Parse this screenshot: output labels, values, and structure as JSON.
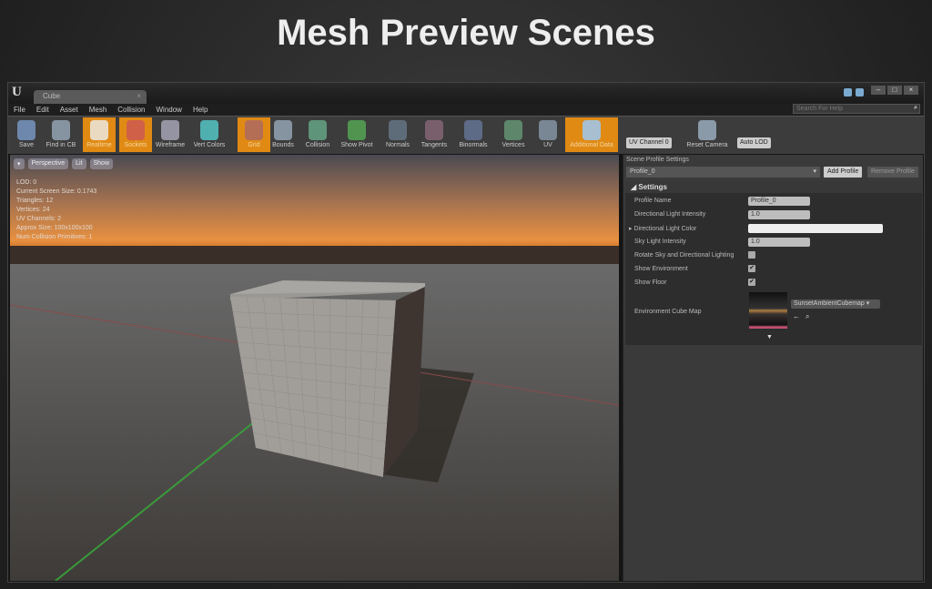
{
  "slide": {
    "title": "Mesh Preview Scenes"
  },
  "window": {
    "tab_title": "Cube",
    "search_placeholder": "Search For Help"
  },
  "menu": [
    "File",
    "Edit",
    "Asset",
    "Mesh",
    "Collision",
    "Window",
    "Help"
  ],
  "toolbar": [
    {
      "label": "Save",
      "icon": "save-icon",
      "active": false
    },
    {
      "label": "Find in CB",
      "icon": "magnifier-icon",
      "active": false
    },
    {
      "label": "Realtime",
      "icon": "stopwatch-icon",
      "active": true
    },
    {
      "label": "Sockets",
      "icon": "socket-icon",
      "active": true
    },
    {
      "label": "Wireframe",
      "icon": "wireframe-icon",
      "active": false
    },
    {
      "label": "Vert Colors",
      "icon": "brush-icon",
      "active": false
    },
    {
      "label": "Grid",
      "icon": "grid-icon",
      "active": true
    },
    {
      "label": "Bounds",
      "icon": "bounds-icon",
      "active": false
    },
    {
      "label": "Collision",
      "icon": "collision-icon",
      "active": false
    },
    {
      "label": "Show Pivot",
      "icon": "pivot-icon",
      "active": false
    },
    {
      "label": "Normals",
      "icon": "normals-icon",
      "active": false
    },
    {
      "label": "Tangents",
      "icon": "tangents-icon",
      "active": false
    },
    {
      "label": "Binormals",
      "icon": "binormals-icon",
      "active": false
    },
    {
      "label": "Vertices",
      "icon": "vertices-icon",
      "active": false
    },
    {
      "label": "UV",
      "icon": "uv-icon",
      "active": false
    },
    {
      "label": "Additional Data",
      "icon": "additional-data-icon",
      "active": true
    }
  ],
  "uv_channel": "UV Channel 0",
  "reset_camera": "Reset Camera",
  "lod": "Auto LOD",
  "viewport": {
    "buttons": [
      "Perspective",
      "Lit",
      "Show"
    ],
    "stats": [
      "LOD:  0",
      "Current Screen Size:  0.1743",
      "Triangles:  12",
      "Vertices:  24",
      "UV Channels:  2",
      "Approx Size: 100x100x100",
      "Num Collision Primitives:  1"
    ]
  },
  "panel": {
    "title": "Scene Profile Settings",
    "profile": "Profile_0",
    "add": "Add Profile",
    "remove": "Remove Profile",
    "section": "Settings",
    "rows": {
      "profile_name": "Profile Name",
      "profile_name_value": "Profile_0",
      "dir_intensity": "Directional Light Intensity",
      "dir_intensity_value": "1.0",
      "dir_color": "Directional Light Color",
      "sky_intensity": "Sky Light Intensity",
      "sky_intensity_value": "1.0",
      "rotate": "Rotate Sky and Directional Lighting",
      "show_env": "Show Environment",
      "show_floor": "Show Floor",
      "cube_map": "Environment Cube Map",
      "cube_map_value": "SunsetAmbientCubemap"
    },
    "checks": {
      "rotate": false,
      "show_env": true,
      "show_floor": true
    }
  },
  "colors": {
    "accent": "#e08a14"
  }
}
